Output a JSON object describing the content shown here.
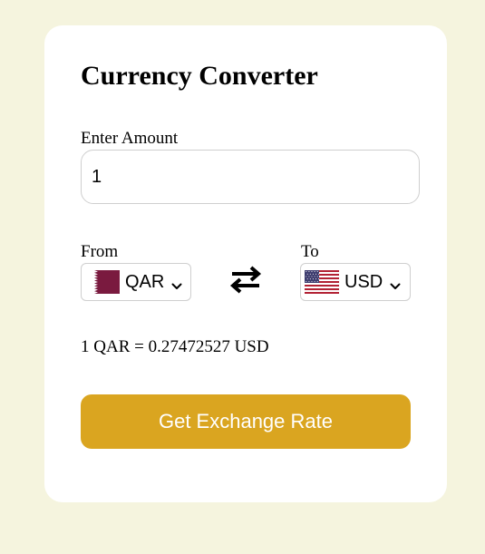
{
  "converter": {
    "title": "Currency Converter",
    "amount_label": "Enter Amount",
    "amount_value": "1",
    "from_label": "From",
    "to_label": "To",
    "from_currency": "QAR",
    "to_currency": "USD",
    "from_flag_icon": "qatar-flag-icon",
    "to_flag_icon": "usa-flag-icon",
    "swap_icon": "swap-arrows-icon",
    "result_text": "1 QAR = 0.27472527 USD",
    "button_label": "Get Exchange Rate"
  },
  "colors": {
    "page_background": "#f5f4de",
    "card_background": "#ffffff",
    "button_background": "#daa520",
    "button_text": "#ffffff",
    "qatar_maroon": "#7a1a3f"
  }
}
